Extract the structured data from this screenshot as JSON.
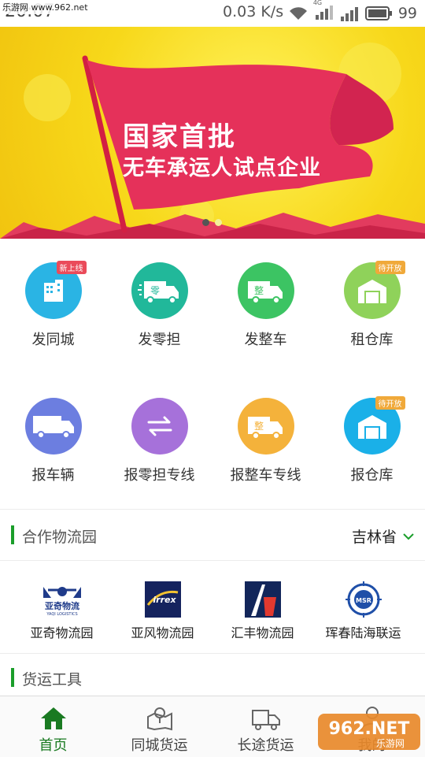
{
  "status_bar": {
    "time": "20:07",
    "watermark": "乐游网 www.962.net",
    "net_speed": "0.03 K/s",
    "network": "4G",
    "battery": "99"
  },
  "banner": {
    "line1": "国家首批",
    "line2": "无车承运人试点企业",
    "page_count": 2,
    "active_page": 1
  },
  "services": [
    {
      "label": "发同城",
      "icon": "building-icon",
      "color": "#2ab4e4",
      "badge": "新上线",
      "badge_color": "#ea4b5a"
    },
    {
      "label": "发零担",
      "icon": "speed-truck-icon",
      "color": "#21b89a",
      "badge": ""
    },
    {
      "label": "发整车",
      "icon": "truck-icon",
      "color": "#3cc463",
      "badge": ""
    },
    {
      "label": "租仓库",
      "icon": "warehouse-icon",
      "color": "#8fd25a",
      "badge": "待开放",
      "badge_color": "#f0a93a"
    },
    {
      "label": "报车辆",
      "icon": "vehicle-icon",
      "color": "#6c7ee0",
      "badge": ""
    },
    {
      "label": "报零担专线",
      "icon": "exchange-arrows-icon",
      "color": "#a671da",
      "badge": ""
    },
    {
      "label": "报整车专线",
      "icon": "truck-icon",
      "color": "#f4b23b",
      "badge": ""
    },
    {
      "label": "报仓库",
      "icon": "warehouse-icon",
      "color": "#1ab0e8",
      "badge": "待开放",
      "badge_color": "#f0a93a"
    }
  ],
  "truck_badge_char": "零",
  "truck_full_char": "整",
  "partners_section": {
    "title": "合作物流园",
    "province": "吉林省",
    "items": [
      {
        "label": "亚奇物流园",
        "logo_text": "亚奇物流",
        "logo_sub": "YAQI LOGISTICS"
      },
      {
        "label": "亚风物流园",
        "logo_text": "irrex"
      },
      {
        "label": "汇丰物流园",
        "logo_text": ""
      },
      {
        "label": "珲春陆海联运",
        "logo_text": "MSR"
      }
    ]
  },
  "tools_section": {
    "title": "货运工具"
  },
  "tabs": [
    {
      "label": "首页",
      "icon": "home-icon",
      "active": true
    },
    {
      "label": "同城货运",
      "icon": "map-pin-icon",
      "active": false
    },
    {
      "label": "长途货运",
      "icon": "truck-outline-icon",
      "active": false
    },
    {
      "label": "我的",
      "icon": "user-icon",
      "active": false
    }
  ],
  "colors": {
    "accent": "#1a9e2a",
    "banner_flag": "#e5315a"
  },
  "corner_watermark": {
    "big": "962.NET",
    "small": "乐游网"
  }
}
